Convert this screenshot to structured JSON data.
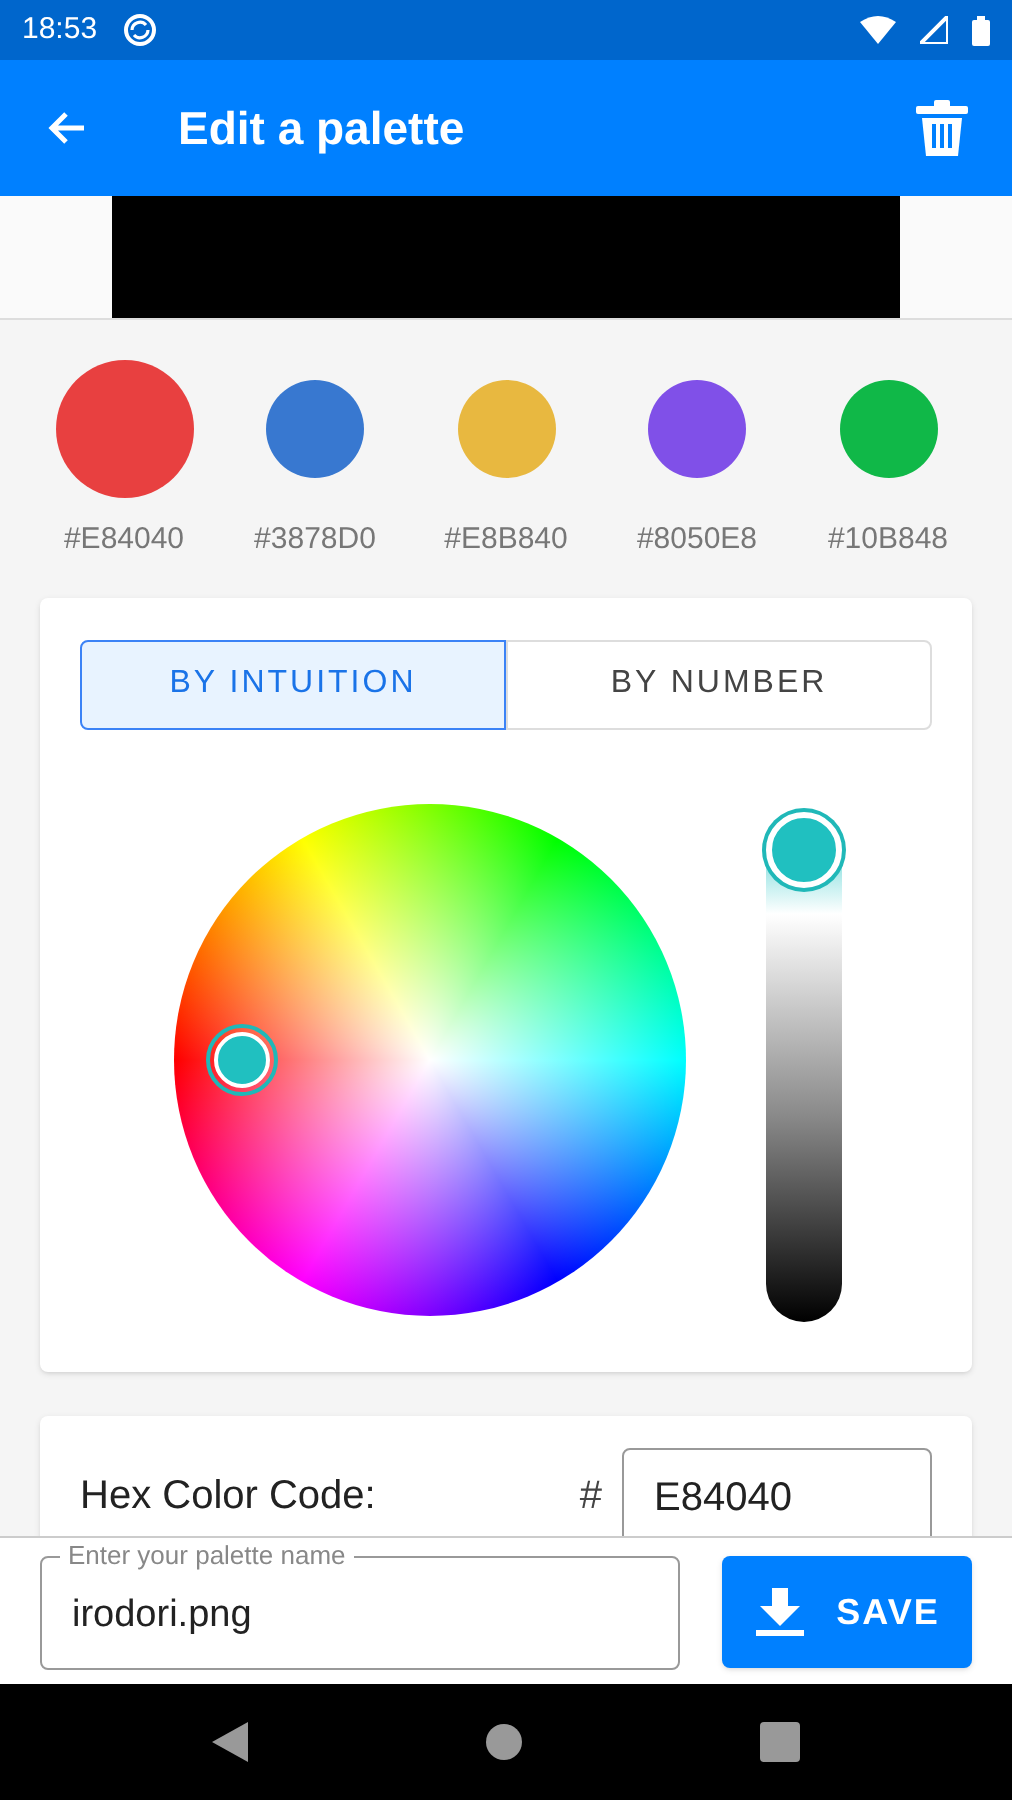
{
  "status_bar": {
    "time": "18:53"
  },
  "app_bar": {
    "title": "Edit a palette"
  },
  "swatches": [
    {
      "label": "#E84040",
      "color": "#e84040",
      "selected": true
    },
    {
      "label": "#3878D0",
      "color": "#3878d0",
      "selected": false
    },
    {
      "label": "#E8B840",
      "color": "#e8b840",
      "selected": false
    },
    {
      "label": "#8050E8",
      "color": "#8050e8",
      "selected": false
    },
    {
      "label": "#10B848",
      "color": "#10b848",
      "selected": false
    }
  ],
  "tabs": [
    {
      "label": "BY INTUITION",
      "selected": true
    },
    {
      "label": "BY NUMBER",
      "selected": false
    }
  ],
  "brightness": {
    "level": 1
  },
  "hex": {
    "label": "Hex Color Code:",
    "prefix": "#",
    "value": "E84040"
  },
  "name_field": {
    "placeholder": "Enter your palette name",
    "value": "irodori.png"
  },
  "save_button": {
    "label": "SAVE"
  }
}
